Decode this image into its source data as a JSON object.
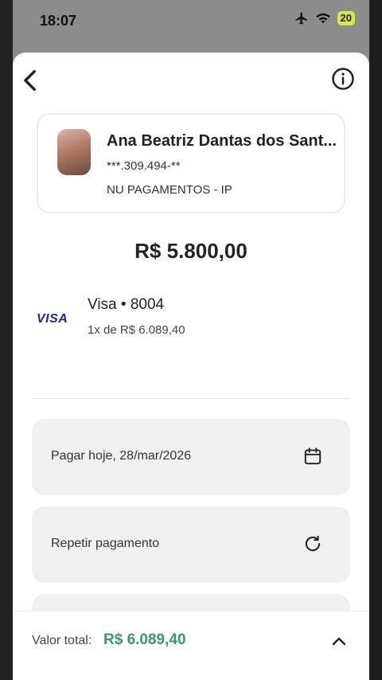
{
  "status_bar": {
    "time": "18:07",
    "battery": "20"
  },
  "recipient": {
    "name": "Ana Beatriz Dantas dos Sant...",
    "document": "***.309.494-**",
    "bank": "NU PAGAMENTOS - IP"
  },
  "amount": "R$ 5.800,00",
  "card": {
    "brand_logo": "VISA",
    "title": "Visa • 8004",
    "installments": "1x de R$ 6.089,40"
  },
  "options": [
    {
      "label": "Pagar hoje, 28/mar/2026",
      "icon": "calendar-icon"
    },
    {
      "label": "Repetir pagamento",
      "icon": "refresh-icon"
    }
  ],
  "footer": {
    "total_label": "Valor total:",
    "total_value": "R$ 6.089,40"
  },
  "colors": {
    "accent_green": "#3a9a6a",
    "visa_blue": "#1a2b8c"
  }
}
